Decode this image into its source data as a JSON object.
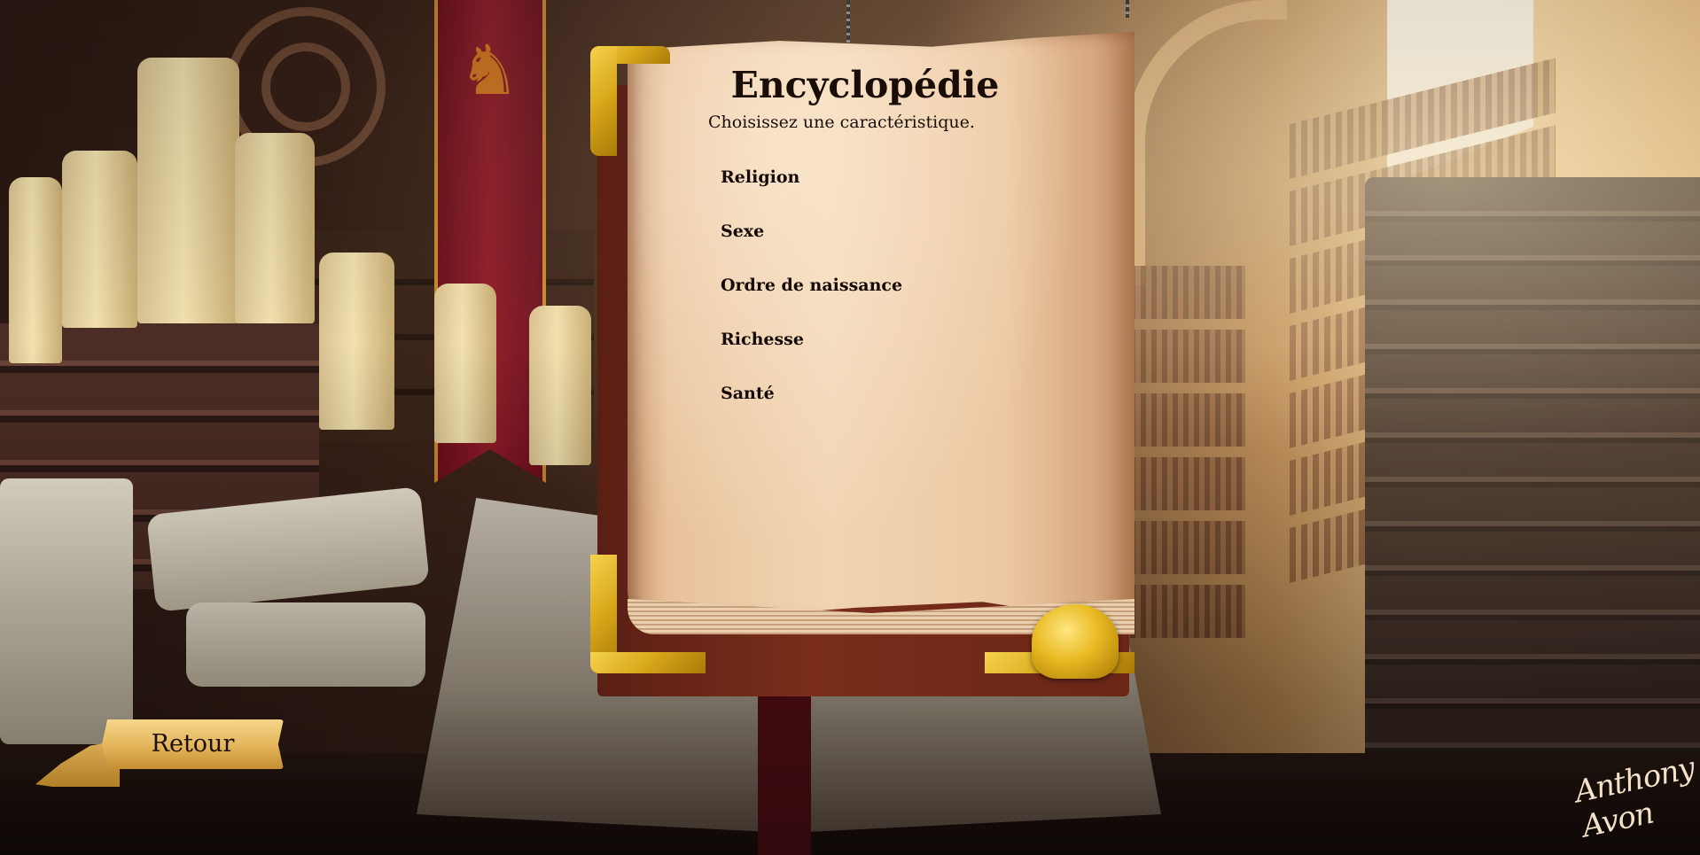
{
  "encyclopedia": {
    "title": "Encyclopédie",
    "subtitle": "Choisissez une caractéristique.",
    "items": [
      {
        "label": "Religion"
      },
      {
        "label": "Sexe"
      },
      {
        "label": "Ordre de naissance"
      },
      {
        "label": "Richesse"
      },
      {
        "label": "Santé"
      }
    ]
  },
  "navigation": {
    "back_label": "Retour"
  },
  "artwork": {
    "signature_text": "Anthony Avon"
  },
  "colors": {
    "page_parchment": "#f1d5b3",
    "book_leather": "#7a2e1b",
    "gold_trim": "#e8b921",
    "banner_red": "#8f1a28",
    "text_dark": "#1a0d08"
  },
  "icons": {
    "banner_emblem": "dragon-icon",
    "book_clasp": "clasp-icon"
  }
}
